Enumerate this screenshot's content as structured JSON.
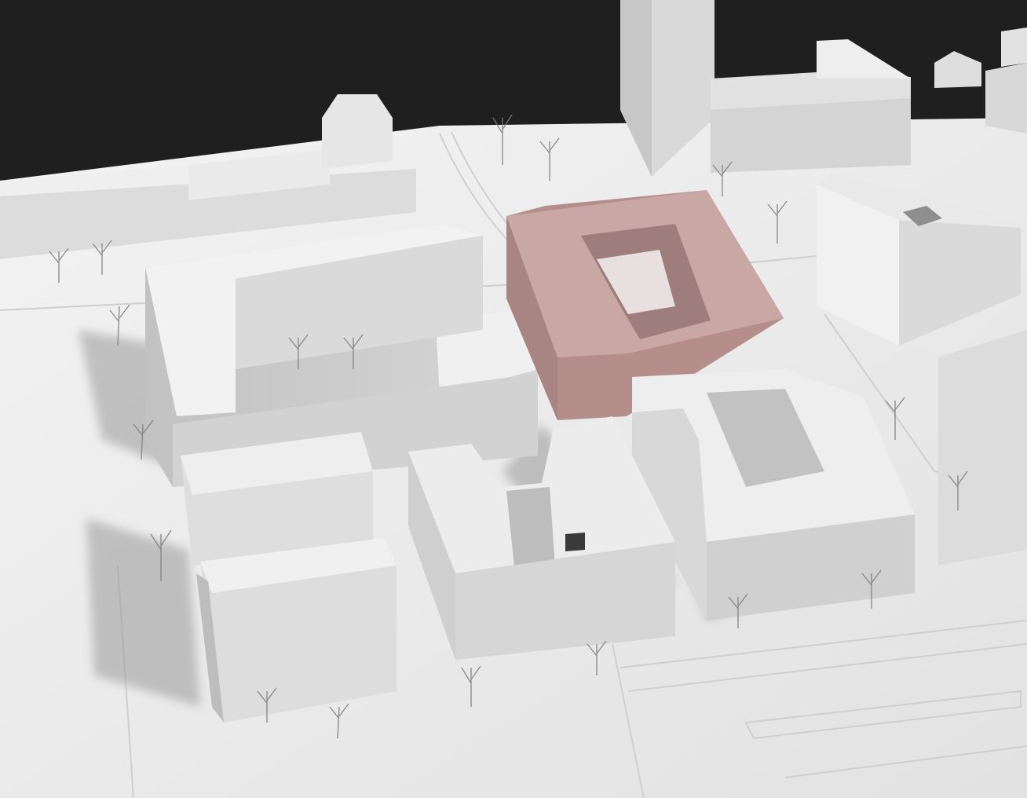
{
  "scene": {
    "subject": "architectural-massing-model",
    "colors": {
      "background": "#1f1f1f",
      "base": "#e9e9e9",
      "block_top": "#ededed",
      "block_side": "#cfcfcf",
      "block_front": "#dedede",
      "highlight_top": "#c9a7a4",
      "highlight_side": "#b78f8c",
      "shadow": "#8c8c8c",
      "trees": "#7d7d7d"
    }
  }
}
